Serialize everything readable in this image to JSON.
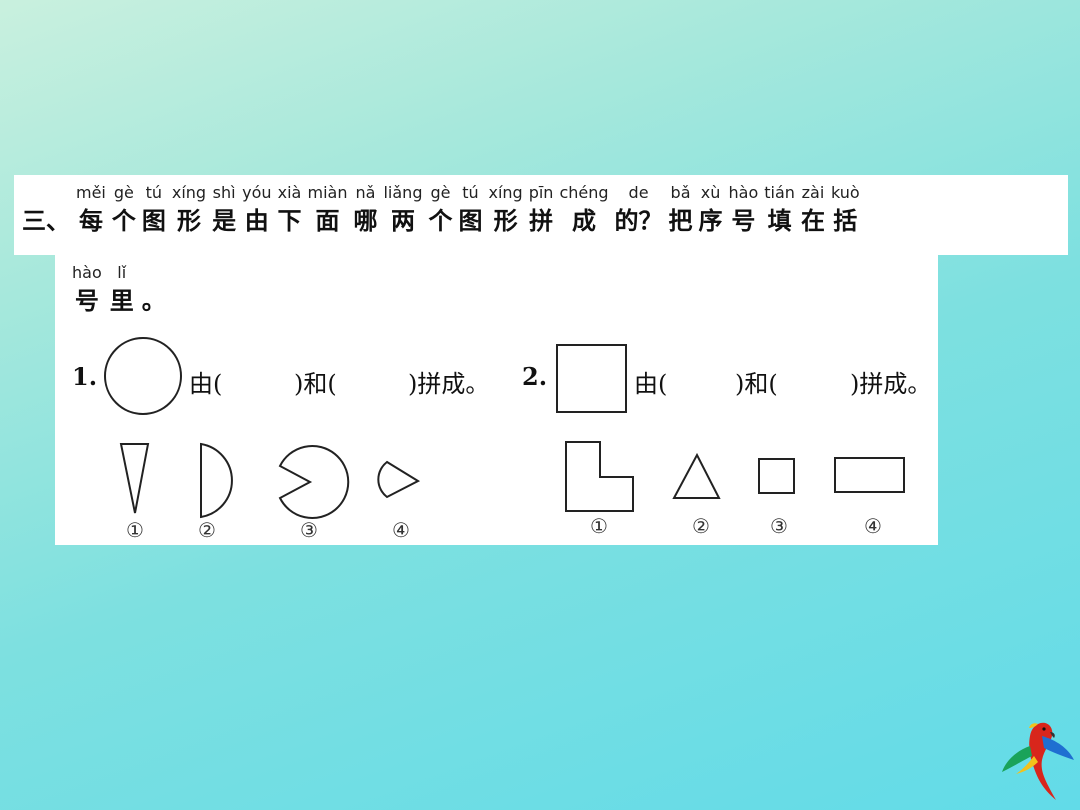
{
  "header": {
    "prefix": "三、",
    "chars": [
      {
        "py": "měi",
        "hz": "每"
      },
      {
        "py": "gè",
        "hz": "个"
      },
      {
        "py": "tú",
        "hz": "图"
      },
      {
        "py": "xíng",
        "hz": "形"
      },
      {
        "py": "shì",
        "hz": "是"
      },
      {
        "py": "yóu",
        "hz": "由"
      },
      {
        "py": "xià",
        "hz": "下"
      },
      {
        "py": "miàn",
        "hz": "面"
      },
      {
        "py": "nǎ",
        "hz": "哪"
      },
      {
        "py": "liǎng",
        "hz": "两"
      },
      {
        "py": "gè",
        "hz": "个"
      },
      {
        "py": "tú",
        "hz": "图"
      },
      {
        "py": "xíng",
        "hz": "形"
      },
      {
        "py": "pīn",
        "hz": "拼"
      },
      {
        "py": "chéng",
        "hz": "成"
      },
      {
        "py": "de",
        "hz": "的？"
      },
      {
        "py": "bǎ",
        "hz": "把"
      },
      {
        "py": "xù",
        "hz": "序"
      },
      {
        "py": "hào",
        "hz": "号"
      },
      {
        "py": "tián",
        "hz": "填"
      },
      {
        "py": "zài",
        "hz": "在"
      },
      {
        "py": "kuò",
        "hz": "括"
      }
    ],
    "continuation": [
      {
        "py": "hào",
        "hz": "号"
      },
      {
        "py": "lǐ",
        "hz": "里"
      },
      {
        "py": "",
        "hz": "。"
      }
    ]
  },
  "q1": {
    "number": "1.",
    "text_a": "由(",
    "text_b": ")和(",
    "text_c": ")拼成。",
    "options": [
      "①",
      "②",
      "③",
      "④"
    ]
  },
  "q2": {
    "number": "2.",
    "text_a": "由(",
    "text_b": ")和(",
    "text_c": ")拼成。",
    "options": [
      "①",
      "②",
      "③",
      "④"
    ]
  }
}
